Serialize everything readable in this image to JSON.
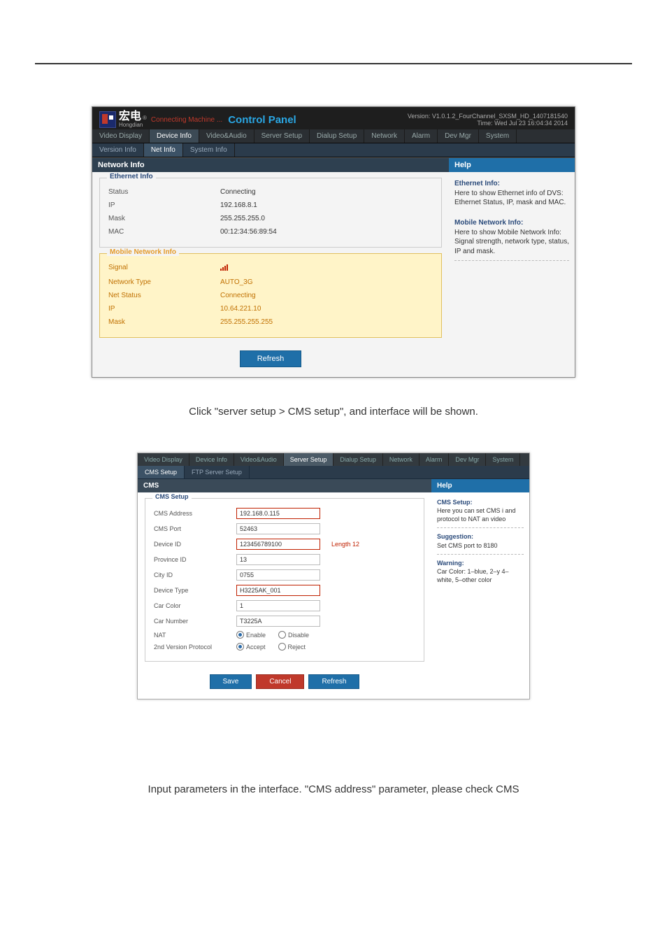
{
  "brand": {
    "cn": "宏电",
    "reg": "®",
    "en": "Hongdian",
    "connecting": "Connecting Machine ...",
    "control_panel": "Control Panel",
    "version": "Version: V1.0.1.2_FourChannel_SXSM_HD_1407181540",
    "time": "Time: Wed Jul 23 16:04:34 2014"
  },
  "primary_tabs": [
    "Video Display",
    "Device Info",
    "Video&Audio",
    "Server Setup",
    "Dialup Setup",
    "Network",
    "Alarm",
    "Dev Mgr",
    "System"
  ],
  "primary_active_index_s1": 1,
  "secondary_tabs_s1": [
    "Version Info",
    "Net Info",
    "System Info"
  ],
  "secondary_active_index_s1": 1,
  "panel_title_s1": "Network Info",
  "ethernet": {
    "legend": "Ethernet Info",
    "rows": [
      {
        "k": "Status",
        "v": "Connecting"
      },
      {
        "k": "IP",
        "v": "192.168.8.1"
      },
      {
        "k": "Mask",
        "v": "255.255.255.0"
      },
      {
        "k": "MAC",
        "v": "00:12:34:56:89:54"
      }
    ]
  },
  "mobile": {
    "legend": "Mobile Network Info",
    "rows": [
      {
        "k": "Signal",
        "v": "signal-bars"
      },
      {
        "k": "Network Type",
        "v": "AUTO_3G"
      },
      {
        "k": "Net Status",
        "v": "Connecting"
      },
      {
        "k": "IP",
        "v": "10.64.221.10"
      },
      {
        "k": "Mask",
        "v": "255.255.255.255"
      }
    ]
  },
  "refresh_label": "Refresh",
  "help1": {
    "title": "Help",
    "h1": "Ethernet Info:",
    "t1": "Here to show Ethernet info of DVS: Ethernet Status, IP, mask and MAC.",
    "h2": "Mobile Network Info:",
    "t2": "Here to show Mobile Network Info: Signal strength, network type, status, IP and mask."
  },
  "caption1": "Click \"server setup > CMS setup\", and interface will be shown.",
  "primary_active_index_s2": 3,
  "secondary_tabs_s2": [
    "CMS Setup",
    "FTP Server Setup"
  ],
  "secondary_active_index_s2": 0,
  "panel_title_s2": "CMS",
  "cms": {
    "legend": "CMS Setup",
    "rows": [
      {
        "k": "CMS Address",
        "v": "192.168.0.115",
        "hl": true
      },
      {
        "k": "CMS Port",
        "v": "52463"
      },
      {
        "k": "Device ID",
        "v": "123456789100",
        "hl": true,
        "len": "Length 12"
      },
      {
        "k": "Province ID",
        "v": "13"
      },
      {
        "k": "City ID",
        "v": "0755"
      },
      {
        "k": "Device Type",
        "v": "H3225AK_001",
        "hl": true
      },
      {
        "k": "Car Color",
        "v": "1"
      },
      {
        "k": "Car Number",
        "v": "T3225A"
      }
    ],
    "nat": {
      "k": "NAT",
      "opt1": "Enable",
      "opt2": "Disable",
      "sel": 0
    },
    "proto": {
      "k": "2nd Version Protocol",
      "opt1": "Accept",
      "opt2": "Reject",
      "sel": 0
    }
  },
  "buttons2": {
    "save": "Save",
    "cancel": "Cancel",
    "refresh": "Refresh"
  },
  "help2": {
    "title": "Help",
    "h1": "CMS Setup:",
    "t1": "Here you can set CMS i and protocol to NAT an video",
    "h2": "Suggestion:",
    "t2": "Set CMS port to 8180",
    "h3": "Warning:",
    "t3": "Car Color: 1–blue, 2–y 4–white, 5–other color"
  },
  "footer_note": "Input parameters in the interface. \"CMS address\" parameter, please check CMS"
}
